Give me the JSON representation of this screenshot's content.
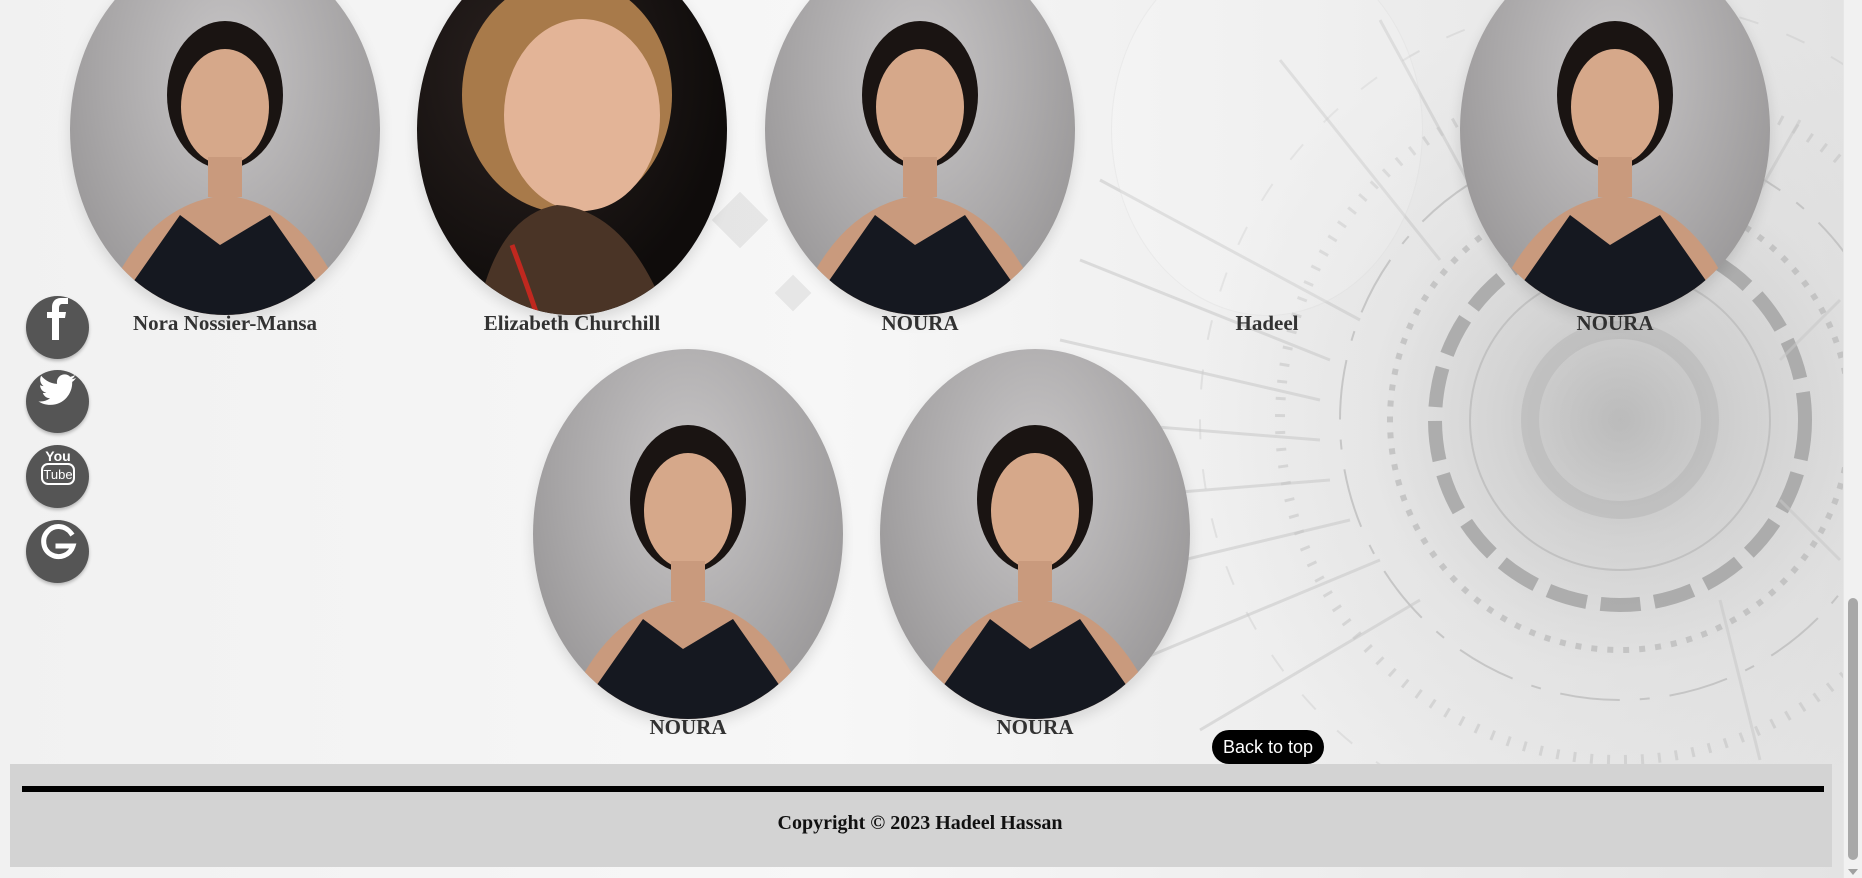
{
  "team": {
    "row1": [
      {
        "name": "Nora Nossier-Mansa",
        "photo": "noura"
      },
      {
        "name": "Elizabeth Churchill",
        "photo": "elizabeth"
      },
      {
        "name": "NOURA",
        "photo": "noura"
      },
      {
        "name": "Hadeel",
        "photo": "empty"
      },
      {
        "name": "NOURA",
        "photo": "noura"
      }
    ],
    "row2": [
      {
        "name": "NOURA",
        "photo": "noura"
      },
      {
        "name": "NOURA",
        "photo": "noura"
      }
    ]
  },
  "social": [
    {
      "icon": "facebook-icon",
      "glyph": "f"
    },
    {
      "icon": "twitter-icon",
      "glyph": "twitter"
    },
    {
      "icon": "youtube-icon",
      "glyph": "You Tube"
    },
    {
      "icon": "google-icon",
      "glyph": "G"
    }
  ],
  "back_to_top": "Back to top",
  "footer": {
    "copyright": "Copyright © 2023 Hadeel Hassan"
  },
  "colors": {
    "social_bg": "#555555",
    "footer_bg": "#d3d3d3",
    "back_to_top_bg": "#000000"
  }
}
